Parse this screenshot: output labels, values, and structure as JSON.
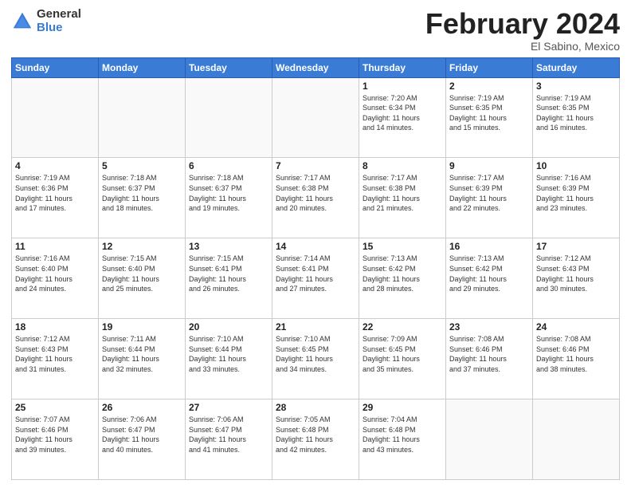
{
  "header": {
    "logo_general": "General",
    "logo_blue": "Blue",
    "month_title": "February 2024",
    "subtitle": "El Sabino, Mexico"
  },
  "weekdays": [
    "Sunday",
    "Monday",
    "Tuesday",
    "Wednesday",
    "Thursday",
    "Friday",
    "Saturday"
  ],
  "weeks": [
    [
      {
        "day": "",
        "info": ""
      },
      {
        "day": "",
        "info": ""
      },
      {
        "day": "",
        "info": ""
      },
      {
        "day": "",
        "info": ""
      },
      {
        "day": "1",
        "info": "Sunrise: 7:20 AM\nSunset: 6:34 PM\nDaylight: 11 hours\nand 14 minutes."
      },
      {
        "day": "2",
        "info": "Sunrise: 7:19 AM\nSunset: 6:35 PM\nDaylight: 11 hours\nand 15 minutes."
      },
      {
        "day": "3",
        "info": "Sunrise: 7:19 AM\nSunset: 6:35 PM\nDaylight: 11 hours\nand 16 minutes."
      }
    ],
    [
      {
        "day": "4",
        "info": "Sunrise: 7:19 AM\nSunset: 6:36 PM\nDaylight: 11 hours\nand 17 minutes."
      },
      {
        "day": "5",
        "info": "Sunrise: 7:18 AM\nSunset: 6:37 PM\nDaylight: 11 hours\nand 18 minutes."
      },
      {
        "day": "6",
        "info": "Sunrise: 7:18 AM\nSunset: 6:37 PM\nDaylight: 11 hours\nand 19 minutes."
      },
      {
        "day": "7",
        "info": "Sunrise: 7:17 AM\nSunset: 6:38 PM\nDaylight: 11 hours\nand 20 minutes."
      },
      {
        "day": "8",
        "info": "Sunrise: 7:17 AM\nSunset: 6:38 PM\nDaylight: 11 hours\nand 21 minutes."
      },
      {
        "day": "9",
        "info": "Sunrise: 7:17 AM\nSunset: 6:39 PM\nDaylight: 11 hours\nand 22 minutes."
      },
      {
        "day": "10",
        "info": "Sunrise: 7:16 AM\nSunset: 6:39 PM\nDaylight: 11 hours\nand 23 minutes."
      }
    ],
    [
      {
        "day": "11",
        "info": "Sunrise: 7:16 AM\nSunset: 6:40 PM\nDaylight: 11 hours\nand 24 minutes."
      },
      {
        "day": "12",
        "info": "Sunrise: 7:15 AM\nSunset: 6:40 PM\nDaylight: 11 hours\nand 25 minutes."
      },
      {
        "day": "13",
        "info": "Sunrise: 7:15 AM\nSunset: 6:41 PM\nDaylight: 11 hours\nand 26 minutes."
      },
      {
        "day": "14",
        "info": "Sunrise: 7:14 AM\nSunset: 6:41 PM\nDaylight: 11 hours\nand 27 minutes."
      },
      {
        "day": "15",
        "info": "Sunrise: 7:13 AM\nSunset: 6:42 PM\nDaylight: 11 hours\nand 28 minutes."
      },
      {
        "day": "16",
        "info": "Sunrise: 7:13 AM\nSunset: 6:42 PM\nDaylight: 11 hours\nand 29 minutes."
      },
      {
        "day": "17",
        "info": "Sunrise: 7:12 AM\nSunset: 6:43 PM\nDaylight: 11 hours\nand 30 minutes."
      }
    ],
    [
      {
        "day": "18",
        "info": "Sunrise: 7:12 AM\nSunset: 6:43 PM\nDaylight: 11 hours\nand 31 minutes."
      },
      {
        "day": "19",
        "info": "Sunrise: 7:11 AM\nSunset: 6:44 PM\nDaylight: 11 hours\nand 32 minutes."
      },
      {
        "day": "20",
        "info": "Sunrise: 7:10 AM\nSunset: 6:44 PM\nDaylight: 11 hours\nand 33 minutes."
      },
      {
        "day": "21",
        "info": "Sunrise: 7:10 AM\nSunset: 6:45 PM\nDaylight: 11 hours\nand 34 minutes."
      },
      {
        "day": "22",
        "info": "Sunrise: 7:09 AM\nSunset: 6:45 PM\nDaylight: 11 hours\nand 35 minutes."
      },
      {
        "day": "23",
        "info": "Sunrise: 7:08 AM\nSunset: 6:46 PM\nDaylight: 11 hours\nand 37 minutes."
      },
      {
        "day": "24",
        "info": "Sunrise: 7:08 AM\nSunset: 6:46 PM\nDaylight: 11 hours\nand 38 minutes."
      }
    ],
    [
      {
        "day": "25",
        "info": "Sunrise: 7:07 AM\nSunset: 6:46 PM\nDaylight: 11 hours\nand 39 minutes."
      },
      {
        "day": "26",
        "info": "Sunrise: 7:06 AM\nSunset: 6:47 PM\nDaylight: 11 hours\nand 40 minutes."
      },
      {
        "day": "27",
        "info": "Sunrise: 7:06 AM\nSunset: 6:47 PM\nDaylight: 11 hours\nand 41 minutes."
      },
      {
        "day": "28",
        "info": "Sunrise: 7:05 AM\nSunset: 6:48 PM\nDaylight: 11 hours\nand 42 minutes."
      },
      {
        "day": "29",
        "info": "Sunrise: 7:04 AM\nSunset: 6:48 PM\nDaylight: 11 hours\nand 43 minutes."
      },
      {
        "day": "",
        "info": ""
      },
      {
        "day": "",
        "info": ""
      }
    ]
  ]
}
